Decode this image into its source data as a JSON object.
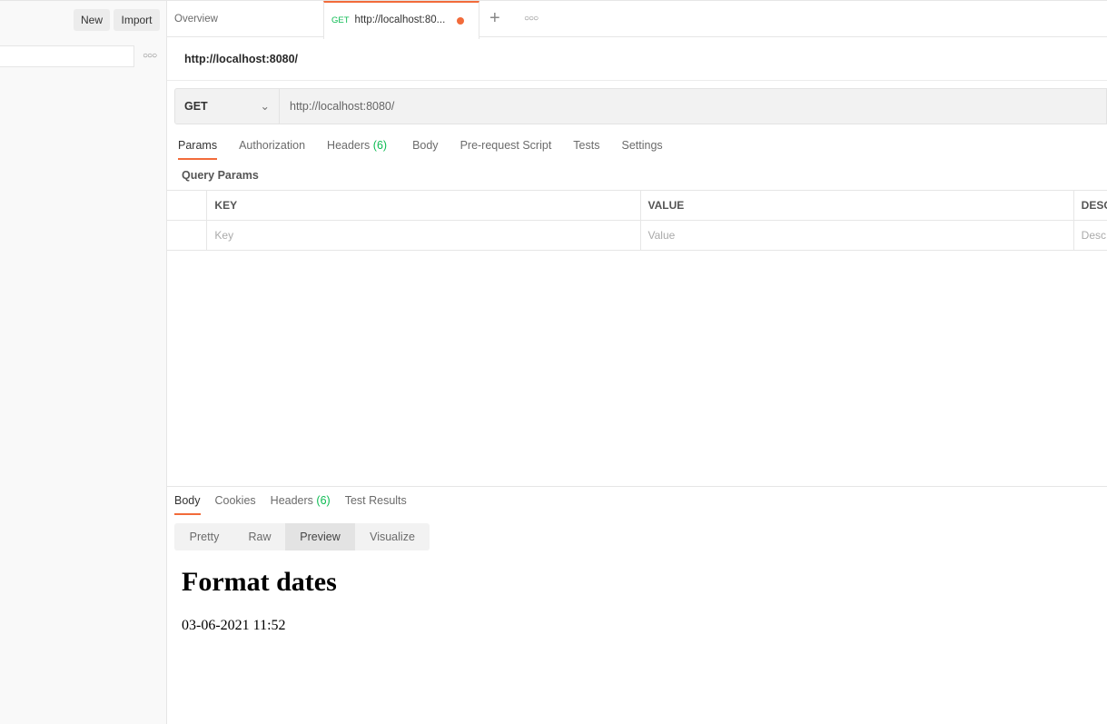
{
  "sidebar": {
    "new_label": "New",
    "import_label": "Import",
    "search_placeholder": "",
    "more_icon": "more-horizontal-icon"
  },
  "tabs": {
    "overview": "Overview",
    "active": {
      "method": "GET",
      "title": "http://localhost:80...",
      "unsaved_color": "#f26b3a"
    },
    "add_icon": "plus-icon",
    "more_icon": "more-horizontal-icon"
  },
  "request": {
    "title": "http://localhost:8080/",
    "method": "GET",
    "url": "http://localhost:8080/"
  },
  "request_tabs": [
    {
      "label": "Params"
    },
    {
      "label": "Authorization"
    },
    {
      "label": "Headers",
      "count": "(6)"
    },
    {
      "label": "Body"
    },
    {
      "label": "Pre-request Script"
    },
    {
      "label": "Tests"
    },
    {
      "label": "Settings"
    }
  ],
  "query_params": {
    "title": "Query Params",
    "columns": [
      "KEY",
      "VALUE",
      "DESC"
    ],
    "placeholders": [
      "Key",
      "Value",
      "Desc"
    ]
  },
  "response_tabs": [
    {
      "label": "Body"
    },
    {
      "label": "Cookies"
    },
    {
      "label": "Headers",
      "count": "(6)"
    },
    {
      "label": "Test Results"
    }
  ],
  "response_modes": [
    "Pretty",
    "Raw",
    "Preview",
    "Visualize"
  ],
  "preview": {
    "heading": "Format dates",
    "text": "03-06-2021 11:52"
  },
  "colors": {
    "accent": "#f26b3a",
    "get": "#0cbb52"
  }
}
